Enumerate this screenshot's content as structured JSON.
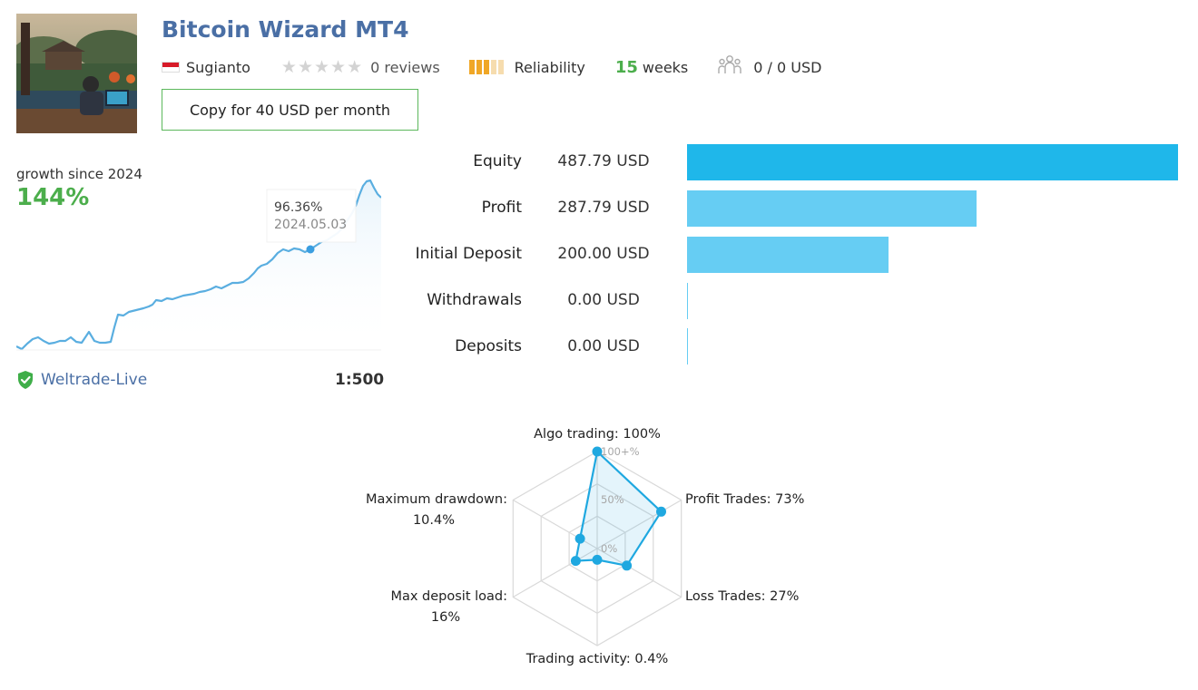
{
  "header": {
    "title": "Bitcoin Wizard MT4",
    "author": "Sugianto",
    "reviews": "0 reviews",
    "rating_stars": 0,
    "reliability_label": "Reliability",
    "reliability_level": 3,
    "weeks_number": "15",
    "weeks_label": "weeks",
    "subscribers": "0 / 0 USD",
    "copy_button": "Copy for 40 USD per month"
  },
  "growth": {
    "label": "growth since 2024",
    "value": "144%",
    "tooltip_value": "96.36%",
    "tooltip_date": "2024.05.03",
    "broker": "Weltrade-Live",
    "leverage": "1:500",
    "line_color": "#5aaee0"
  },
  "stats": [
    {
      "label": "Equity",
      "value": "487.79 USD",
      "amount": 487.79,
      "color": "#1fb7ea"
    },
    {
      "label": "Profit",
      "value": "287.79 USD",
      "amount": 287.79,
      "color": "#66cdf3"
    },
    {
      "label": "Initial Deposit",
      "value": "200.00 USD",
      "amount": 200.0,
      "color": "#66cdf3"
    },
    {
      "label": "Withdrawals",
      "value": "0.00 USD",
      "amount": 0,
      "color": "#66cdf3"
    },
    {
      "label": "Deposits",
      "value": "0.00 USD",
      "amount": 0,
      "color": "#66cdf3"
    }
  ],
  "radar": {
    "labels": {
      "algo": "Algo trading: 100%",
      "profit": "Profit Trades: 73%",
      "loss": "Loss Trades: 27%",
      "activity": "Trading activity: 0.4%",
      "load_1": "Max deposit load:",
      "load_2": "16%",
      "drawdown_1": "Maximum drawdown:",
      "drawdown_2": "10.4%"
    },
    "ticks": {
      "t100": "100+%",
      "t50": "50%",
      "t0": "0%"
    },
    "values": [
      100,
      73,
      27,
      0.4,
      16,
      10.4
    ],
    "color": "#1fa8e0"
  }
}
